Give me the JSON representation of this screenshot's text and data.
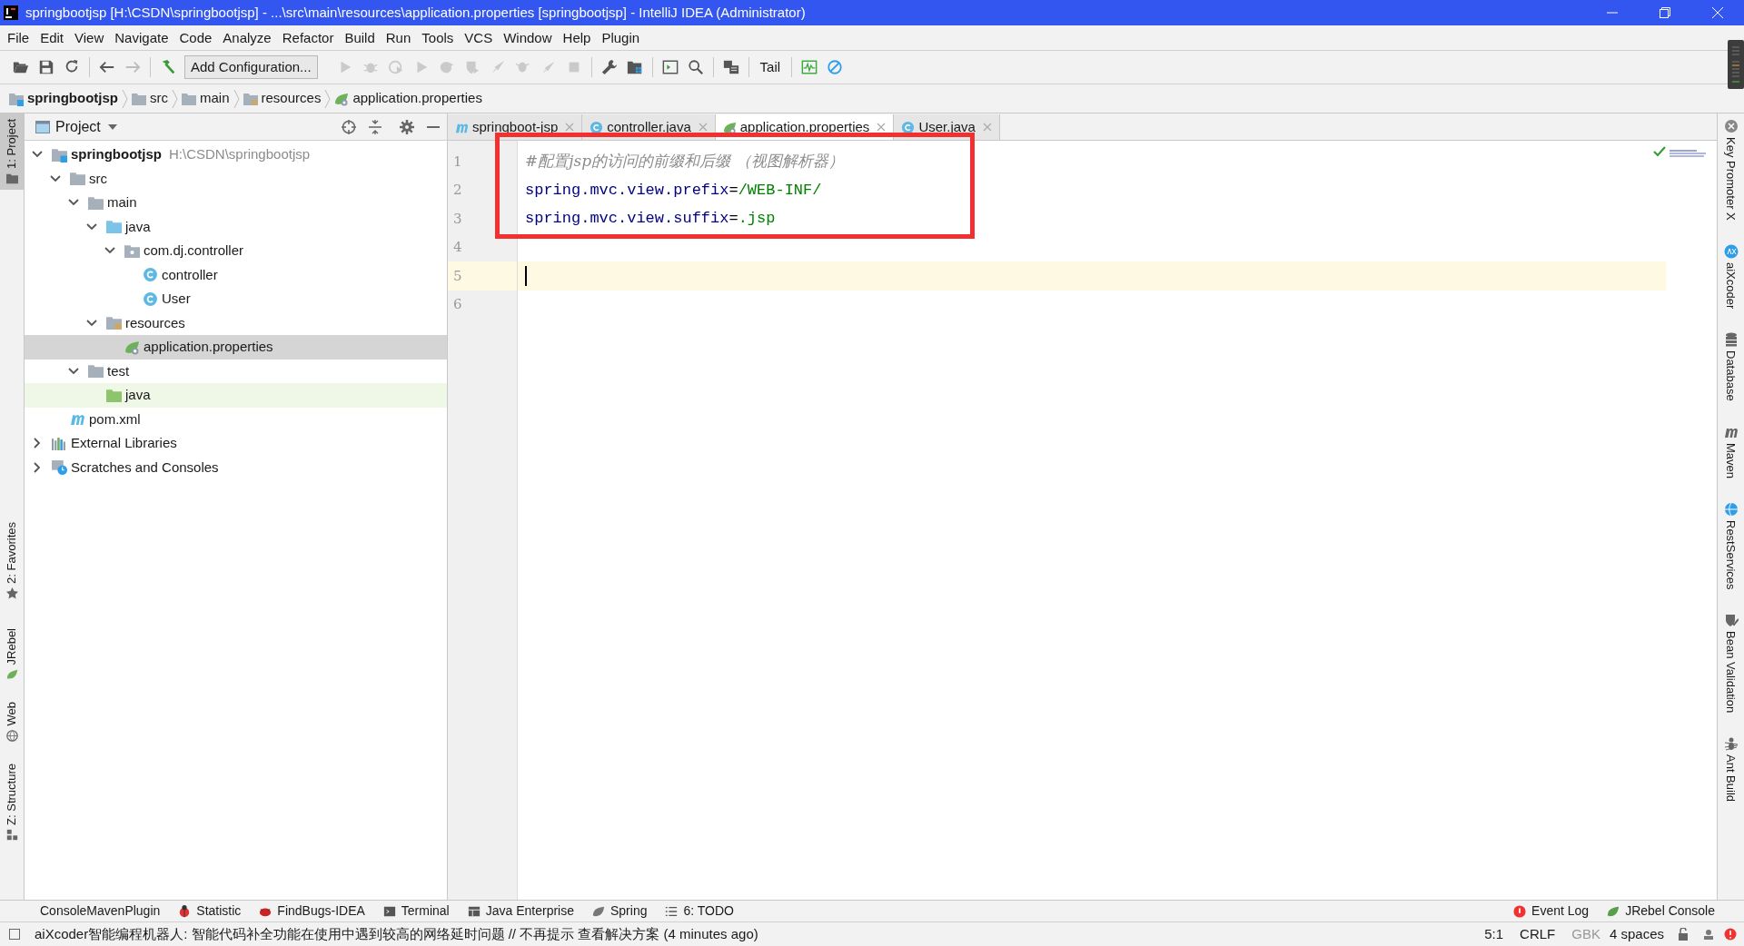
{
  "title_bar": {
    "title": "springbootjsp [H:\\CSDN\\springbootjsp] - ...\\src\\main\\resources\\application.properties [springbootjsp] - IntelliJ IDEA (Administrator)"
  },
  "menu": [
    "File",
    "Edit",
    "View",
    "Navigate",
    "Code",
    "Analyze",
    "Refactor",
    "Build",
    "Run",
    "Tools",
    "VCS",
    "Window",
    "Help",
    "Plugin"
  ],
  "toolbar": {
    "run_configuration": "Add Configuration...",
    "tail": "Tail"
  },
  "breadcrumbs": [
    {
      "label": "springbootjsp",
      "kind": "module"
    },
    {
      "label": "src",
      "kind": "folder"
    },
    {
      "label": "main",
      "kind": "folder"
    },
    {
      "label": "resources",
      "kind": "resources"
    },
    {
      "label": "application.properties",
      "kind": "properties"
    }
  ],
  "left_strip": [
    {
      "label": "1: Project",
      "selected": true
    },
    {
      "label": "2: Favorites",
      "selected": false
    },
    {
      "label": "JRebel",
      "selected": false
    },
    {
      "label": "Web",
      "selected": false
    },
    {
      "label": "Z: Structure",
      "selected": false
    }
  ],
  "project_panel": {
    "title": "Project",
    "tree": [
      {
        "label": "springbootjsp",
        "kind": "module",
        "path": "H:\\CSDN\\springbootjsp",
        "expanded": true,
        "selected": false,
        "children": [
          {
            "label": "src",
            "kind": "folder",
            "expanded": true,
            "selected": false,
            "children": [
              {
                "label": "main",
                "kind": "folder",
                "expanded": true,
                "selected": false,
                "children": [
                  {
                    "label": "java",
                    "kind": "source",
                    "expanded": true,
                    "selected": false,
                    "children": [
                      {
                        "label": "com.dj.controller",
                        "kind": "package",
                        "expanded": true,
                        "selected": false,
                        "children": [
                          {
                            "label": "controller",
                            "kind": "class",
                            "selected": false
                          },
                          {
                            "label": "User",
                            "kind": "class",
                            "selected": false
                          }
                        ]
                      }
                    ]
                  },
                  {
                    "label": "resources",
                    "kind": "resources",
                    "expanded": true,
                    "selected": false,
                    "children": [
                      {
                        "label": "application.properties",
                        "kind": "properties",
                        "selected": true
                      }
                    ]
                  }
                ]
              },
              {
                "label": "test",
                "kind": "folder",
                "expanded": true,
                "selected": false,
                "children": [
                  {
                    "label": "java",
                    "kind": "test-source",
                    "selected": false
                  }
                ]
              }
            ]
          },
          {
            "label": "pom.xml",
            "kind": "maven",
            "selected": false
          }
        ]
      },
      {
        "label": "External Libraries",
        "kind": "libraries",
        "expanded": false,
        "selected": false
      },
      {
        "label": "Scratches and Consoles",
        "kind": "scratches",
        "expanded": false,
        "selected": false
      }
    ]
  },
  "editor_tabs": [
    {
      "label": "springboot-jsp",
      "kind": "maven",
      "selected": false
    },
    {
      "label": "controller.java",
      "kind": "class",
      "selected": false
    },
    {
      "label": "application.properties",
      "kind": "properties",
      "selected": true
    },
    {
      "label": "User.java",
      "kind": "class",
      "selected": false
    }
  ],
  "editor": {
    "lines": [
      {
        "number": "1",
        "kind": "comment",
        "text": "#配置jsp的访问的前缀和后缀 （视图解析器）",
        "boxed": true,
        "current": false
      },
      {
        "number": "2",
        "kind": "property",
        "key": "spring.mvc.view.prefix",
        "separator": "=",
        "value": "/WEB-INF/",
        "boxed": true,
        "current": false
      },
      {
        "number": "3",
        "kind": "property",
        "key": "spring.mvc.view.suffix",
        "separator": "=",
        "value": ".jsp",
        "boxed": true,
        "current": false
      },
      {
        "number": "4",
        "kind": "empty",
        "boxed": false,
        "current": false
      },
      {
        "number": "5",
        "kind": "empty",
        "boxed": false,
        "current": true
      },
      {
        "number": "6",
        "kind": "empty",
        "boxed": false,
        "current": false
      }
    ]
  },
  "right_strip": [
    "Key Promoter X",
    "aiXcoder",
    "Database",
    "Maven",
    "RestServices",
    "Bean Validation",
    "Ant Build"
  ],
  "bottom_tools": {
    "left": [
      "ConsoleMavenPlugin",
      "Statistic",
      "FindBugs-IDEA",
      "Terminal",
      "Java Enterprise",
      "Spring",
      "6: TODO"
    ],
    "right": [
      "Event Log",
      "JRebel Console"
    ]
  },
  "status_bar": {
    "message": "aiXcoder智能编程机器人: 智能代码补全功能在使用中遇到较高的网络延时问题 // 不再提示 查看解决方案 (4 minutes ago)",
    "position": "5:1",
    "line_separator": "CRLF",
    "encoding": "GBK",
    "indent": "4 spaces"
  }
}
